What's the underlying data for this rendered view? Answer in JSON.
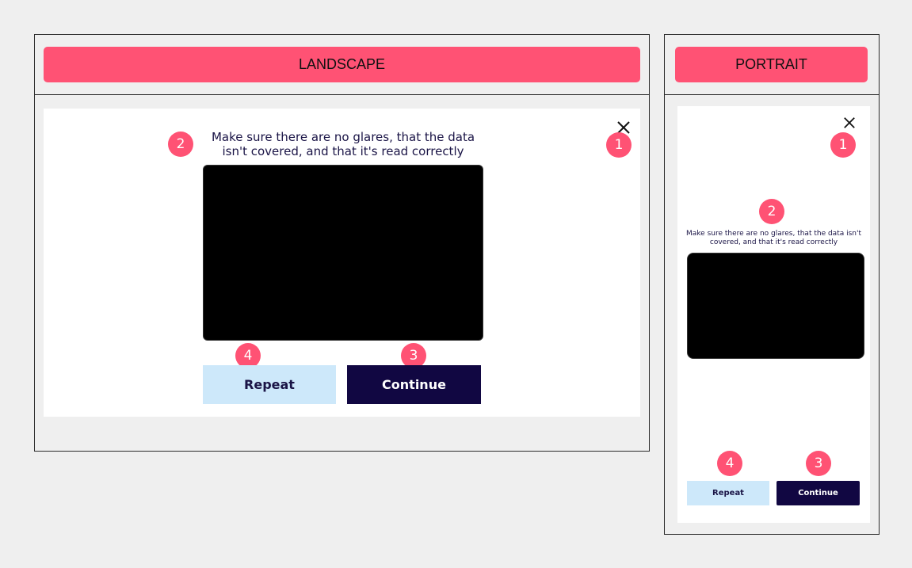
{
  "landscape": {
    "title": "LANDSCAPE",
    "instruction": "Make sure there are no glares, that the data isn't covered, and that it's read correctly",
    "repeat_label": "Repeat",
    "continue_label": "Continue",
    "badges": {
      "close": "1",
      "instruction": "2",
      "continue": "3",
      "repeat": "4"
    }
  },
  "portrait": {
    "title": "PORTRAIT",
    "instruction": "Make sure there are no glares, that the data isn't covered, and that it's read correctly",
    "repeat_label": "Repeat",
    "continue_label": "Continue",
    "badges": {
      "close": "1",
      "instruction": "2",
      "continue": "3",
      "repeat": "4"
    }
  },
  "colors": {
    "accent": "#ff5274",
    "primary_button": "#110742",
    "secondary_button": "#cde8fa",
    "text_dark": "#1a1446"
  }
}
